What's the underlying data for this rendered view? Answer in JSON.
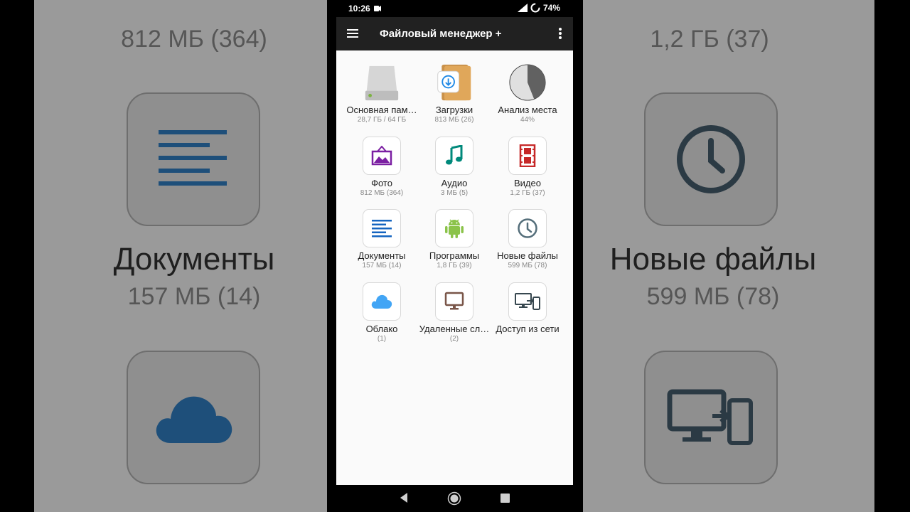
{
  "status": {
    "time": "10:26",
    "battery": "74%"
  },
  "app": {
    "title": "Файловый менеджер +"
  },
  "items": [
    {
      "label": "Основная пам…",
      "sub": "28,7 ГБ / 64 ГБ",
      "icon": "hard-drive-icon"
    },
    {
      "label": "Загрузки",
      "sub": "813 МБ (26)",
      "icon": "download-folder-icon"
    },
    {
      "label": "Анализ места",
      "sub": "44%",
      "icon": "pie-chart-icon",
      "percent": 44
    },
    {
      "label": "Фото",
      "sub": "812 МБ (364)",
      "icon": "photo-icon"
    },
    {
      "label": "Аудио",
      "sub": "3 МБ (5)",
      "icon": "music-note-icon"
    },
    {
      "label": "Видео",
      "sub": "1,2 ГБ (37)",
      "icon": "film-icon"
    },
    {
      "label": "Документы",
      "sub": "157 МБ (14)",
      "icon": "document-icon"
    },
    {
      "label": "Программы",
      "sub": "1,8 ГБ (39)",
      "icon": "android-icon"
    },
    {
      "label": "Новые файлы",
      "sub": "599 МБ (78)",
      "icon": "clock-icon"
    },
    {
      "label": "Облако",
      "sub": "(1)",
      "icon": "cloud-icon"
    },
    {
      "label": "Удаленные сл…",
      "sub": "(2)",
      "icon": "monitor-icon"
    },
    {
      "label": "Доступ из сети",
      "sub": "",
      "icon": "devices-icon"
    }
  ],
  "background": {
    "left": {
      "top_sub": "812 МБ (364)",
      "mid_title": "Документы",
      "mid_sub": "157 МБ (14)"
    },
    "right": {
      "top_sub": "1,2 ГБ (37)",
      "mid_title": "Новые файлы",
      "mid_sub": "599 МБ (78)"
    }
  },
  "colors": {
    "appbar": "#212121",
    "photo": "#7b1fa2",
    "audio": "#00897b",
    "video": "#c62828",
    "documents": "#1565c0",
    "android": "#8bc34a",
    "clock": "#546e7a",
    "cloud": "#42a5f5",
    "monitor": "#795548",
    "devices": "#37474f"
  }
}
